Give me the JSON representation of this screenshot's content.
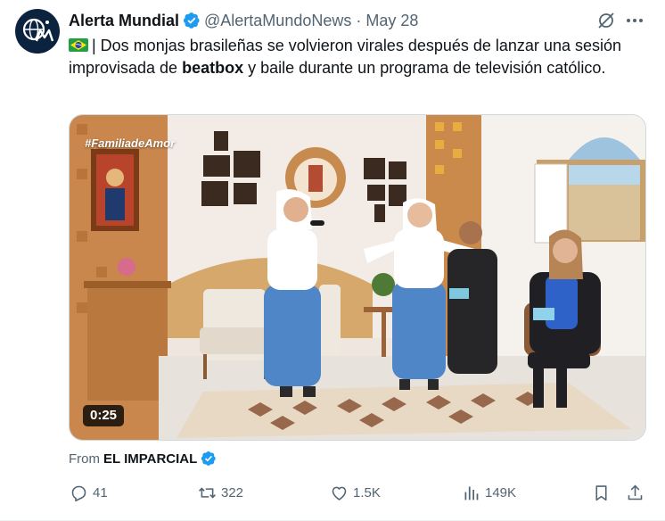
{
  "tweet": {
    "author": {
      "display_name": "Alerta Mundial",
      "handle": "@AlertaMundoNews",
      "verified": true,
      "avatar_icon": "alerta-mundial-logo"
    },
    "separator": "·",
    "date": "May 28",
    "text": {
      "flag_icon": "brazil-flag-emoji",
      "part1": "| Dos monjas brasileñas se volvieron virales después de lanzar una sesión improvisada de ",
      "bold": "beatbox",
      "part2": " y baile durante un programa de televisión católico."
    },
    "media": {
      "overlay_tag": "#FamiliadeAmor",
      "duration": "0:25"
    },
    "source": {
      "prefix": "From",
      "name": "EL IMPARCIAL",
      "verified": true
    },
    "actions": {
      "replies": "41",
      "retweets": "322",
      "likes": "1.5K",
      "views": "149K"
    }
  },
  "colors": {
    "text_primary": "#0f1419",
    "text_secondary": "#536471",
    "verified_blue": "#1d9bf0",
    "border": "#cfd9de"
  }
}
